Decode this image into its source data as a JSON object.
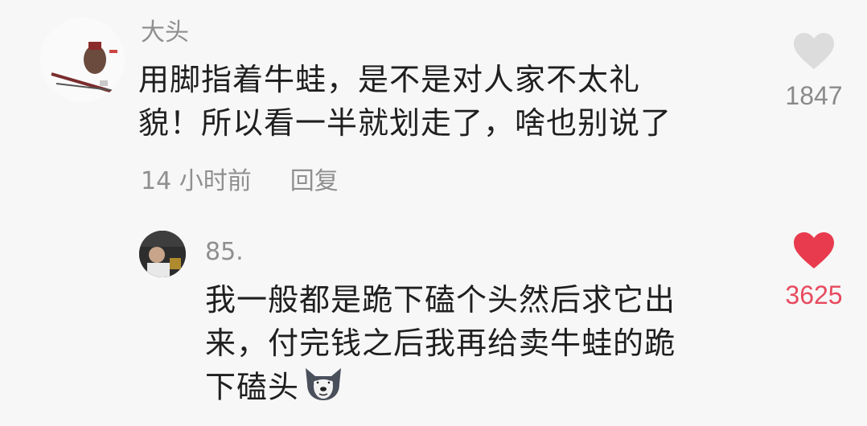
{
  "comments": [
    {
      "username": "大头",
      "text_lines": [
        "用脚指着牛蛙，是不是对人家不太礼",
        "貌！所以看一半就划走了，啥也别说了"
      ],
      "time": "14 小时前",
      "reply_label": "回复",
      "likes": "1847",
      "liked": false,
      "like_color": "#dcdcdc"
    },
    {
      "username": "85.",
      "text_lines": [
        "我一般都是跪下磕个头然后求它出",
        "来，付完钱之后我再给卖牛蛙的跪",
        "下磕头"
      ],
      "emoji": "doge-icon",
      "likes": "3625",
      "liked": true,
      "like_color": "#e83b4e"
    }
  ]
}
